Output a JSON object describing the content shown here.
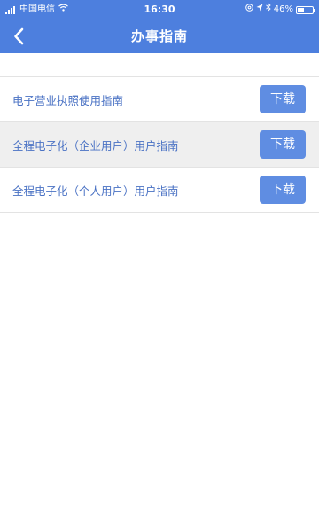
{
  "status_bar": {
    "carrier": "中国电信",
    "time": "16:30",
    "battery": "46%",
    "battery_level": 0.46,
    "icons": [
      "signal-icon",
      "wifi-icon",
      "at-icon",
      "location-icon",
      "bluetooth-icon",
      "battery-icon"
    ]
  },
  "nav": {
    "title": "办事指南",
    "back_icon": "chevron-left-icon"
  },
  "guides": [
    {
      "label": "电子营业执照使用指南",
      "button": "下载"
    },
    {
      "label": "全程电子化（企业用户）用户指南",
      "button": "下载"
    },
    {
      "label": "全程电子化（个人用户）用户指南",
      "button": "下载"
    }
  ],
  "colors": {
    "header_bg": "#4d7fde",
    "button_bg": "#5f8de2",
    "label_text": "#4a72c4",
    "alt_row_bg": "#efefef"
  }
}
